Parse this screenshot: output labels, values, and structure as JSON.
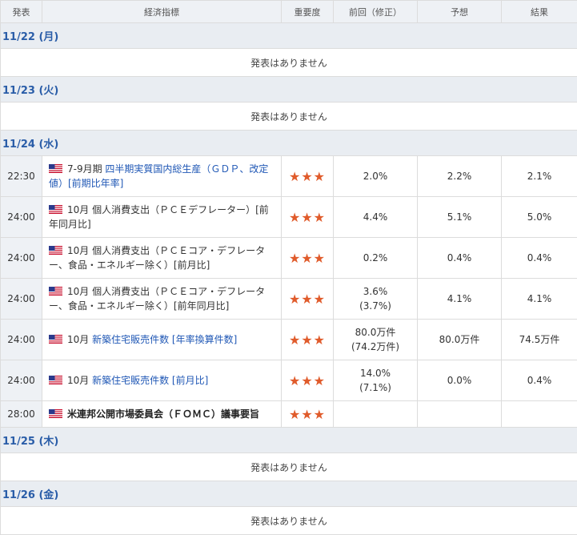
{
  "header": {
    "col_time": "発表",
    "col_name": "経済指標",
    "col_importance": "重要度",
    "col_prev": "前回（修正）",
    "col_forecast": "予想",
    "col_result": "結果"
  },
  "no_events": "発表はありません",
  "stars": "★★★",
  "days": [
    {
      "date": "11/22 (月)"
    },
    {
      "date": "11/23 (火)"
    },
    {
      "date": "11/24 (水)"
    },
    {
      "date": "11/25 (木)"
    },
    {
      "date": "11/26 (金)"
    }
  ],
  "events": [
    {
      "time": "22:30",
      "prefix": "7-9月期 ",
      "link": "四半期実質国内総生産（ＧＤＰ、改定値）[前期比年率]",
      "prev": "2.0%",
      "prev_rev": "",
      "forecast": "2.2%",
      "result": "2.1%"
    },
    {
      "time": "24:00",
      "prefix": "10月 個人消費支出（ＰＣＥデフレーター）[前年同月比]",
      "link": "",
      "prev": "4.4%",
      "prev_rev": "",
      "forecast": "5.1%",
      "result": "5.0%"
    },
    {
      "time": "24:00",
      "prefix": "10月 個人消費支出（ＰＣＥコア・デフレーター、食品・エネルギー除く）[前月比]",
      "link": "",
      "prev": "0.2%",
      "prev_rev": "",
      "forecast": "0.4%",
      "result": "0.4%"
    },
    {
      "time": "24:00",
      "prefix": "10月 個人消費支出（ＰＣＥコア・デフレーター、食品・エネルギー除く）[前年同月比]",
      "link": "",
      "prev": "3.6%",
      "prev_rev": "(3.7%)",
      "forecast": "4.1%",
      "result": "4.1%"
    },
    {
      "time": "24:00",
      "prefix": "10月 ",
      "link": "新築住宅販売件数 [年率換算件数]",
      "prev": "80.0万件",
      "prev_rev": "(74.2万件)",
      "forecast": "80.0万件",
      "result": "74.5万件"
    },
    {
      "time": "24:00",
      "prefix": "10月 ",
      "link": "新築住宅販売件数 [前月比]",
      "prev": "14.0%",
      "prev_rev": "(7.1%)",
      "forecast": "0.0%",
      "result": "0.4%"
    },
    {
      "time": "28:00",
      "prefix": "米連邦公開市場委員会（ＦＯＭＣ）議事要旨",
      "link": "",
      "prev": "",
      "prev_rev": "",
      "forecast": "",
      "result": ""
    }
  ],
  "colors": {
    "accent": "#2a5da8",
    "star": "#e05b2b",
    "date_bg": "#e9edf2"
  },
  "icons": {
    "flag": "us-flag-icon"
  }
}
